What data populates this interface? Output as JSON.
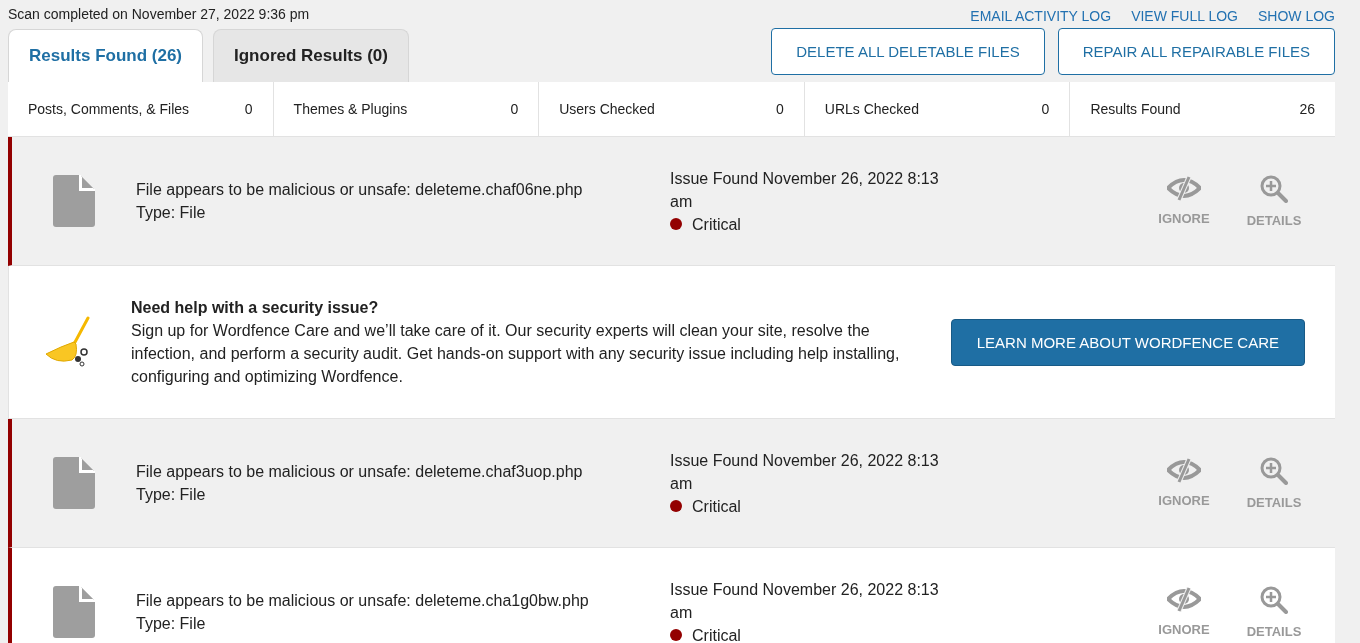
{
  "scan_status": "Scan completed on November 27, 2022 9:36 pm",
  "log_links": [
    "EMAIL ACTIVITY LOG",
    "VIEW FULL LOG",
    "SHOW LOG"
  ],
  "tabs": [
    {
      "label": "Results Found (26)",
      "selected": true
    },
    {
      "label": "Ignored Results (0)",
      "selected": false
    }
  ],
  "action_buttons": [
    "DELETE ALL DELETABLE FILES",
    "REPAIR ALL REPAIRABLE FILES"
  ],
  "stats": [
    {
      "label": "Posts, Comments, & Files",
      "value": "0"
    },
    {
      "label": "Themes & Plugins",
      "value": "0"
    },
    {
      "label": "Users Checked",
      "value": "0"
    },
    {
      "label": "URLs Checked",
      "value": "0"
    },
    {
      "label": "Results Found",
      "value": "26"
    }
  ],
  "items": [
    {
      "kind": "issue",
      "title": "File appears to be malicious or unsafe: deleteme.chaf06ne.php",
      "type": "Type: File",
      "found": "Issue Found November 26, 2022 8:13 am",
      "severity": "Critical",
      "color": "#930000",
      "actions": [
        "IGNORE",
        "DETAILS"
      ]
    },
    {
      "kind": "promo",
      "heading": "Need help with a security issue?",
      "body": "Sign up for Wordfence Care and we’ll take care of it. Our security experts will clean your site, resolve the infection, and perform a security audit. Get hands-on support with any security issue including help installing, configuring and optimizing Wordfence.",
      "button": "LEARN MORE ABOUT WORDFENCE CARE"
    },
    {
      "kind": "issue",
      "title": "File appears to be malicious or unsafe: deleteme.chaf3uop.php",
      "type": "Type: File",
      "found": "Issue Found November 26, 2022 8:13 am",
      "severity": "Critical",
      "color": "#930000",
      "actions": [
        "IGNORE",
        "DETAILS"
      ]
    },
    {
      "kind": "issue",
      "title": "File appears to be malicious or unsafe: deleteme.cha1g0bw.php",
      "type": "Type: File",
      "found": "Issue Found November 26, 2022 8:13 am",
      "severity": "Critical",
      "color": "#930000",
      "actions": [
        "IGNORE",
        "DETAILS"
      ]
    }
  ]
}
